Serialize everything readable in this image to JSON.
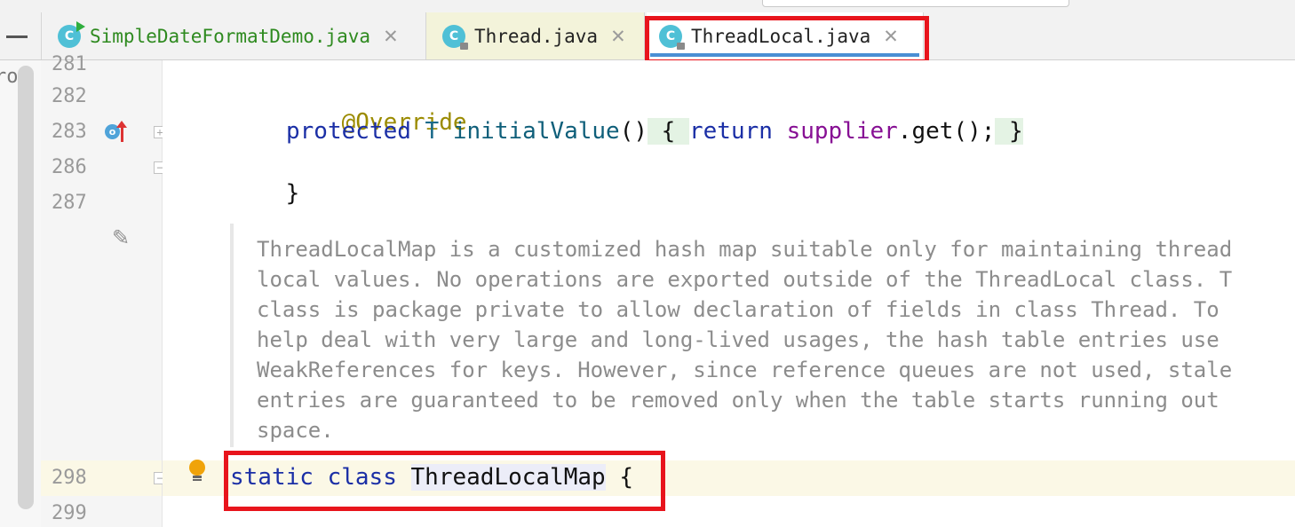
{
  "tabs": [
    {
      "label": "SimpleDateFormatDemo.java",
      "icon": "class-run-icon",
      "active": false
    },
    {
      "label": "Thread.java",
      "icon": "class-readonly-icon",
      "active": false
    },
    {
      "label": "ThreadLocal.java",
      "icon": "class-readonly-icon",
      "active": true
    }
  ],
  "tab_close_glyph": "✕",
  "class_icon_letter": "C",
  "left_strip_text": "ro",
  "gutter": {
    "lines": [
      "281",
      "282",
      "283",
      "286",
      "287",
      "298",
      "299"
    ],
    "override_letter": "o"
  },
  "code": {
    "l282": "@Override",
    "l283_kw": "protected",
    "l283_type": "T",
    "l283_method": "initialValue",
    "l283_paren": "()",
    "l283_lbrace": " { ",
    "l283_return": "return",
    "l283_field": "supplier",
    "l283_call": ".get();",
    "l283_rbrace": " }",
    "l286": "}",
    "l298_static": "static",
    "l298_class": "class",
    "l298_name": "ThreadLocalMap",
    "l298_brace": " {"
  },
  "doc_lines": [
    "ThreadLocalMap is a customized hash map suitable only for maintaining thread",
    "local values. No operations are exported outside of the ThreadLocal class. T",
    "class is package private to allow declaration of fields in class Thread. To",
    "help deal with very large and long-lived usages, the hash table entries use",
    "WeakReferences for keys. However, since reference queues are not used, stale",
    "entries are guaranteed to be removed only when the table starts running out",
    "space."
  ],
  "colors": {
    "highlight_box": "#e8141c",
    "active_tab_underline": "#4a8fd4",
    "keyword": "#1b2fa6",
    "annotation": "#9b8b00",
    "field": "#871094"
  }
}
